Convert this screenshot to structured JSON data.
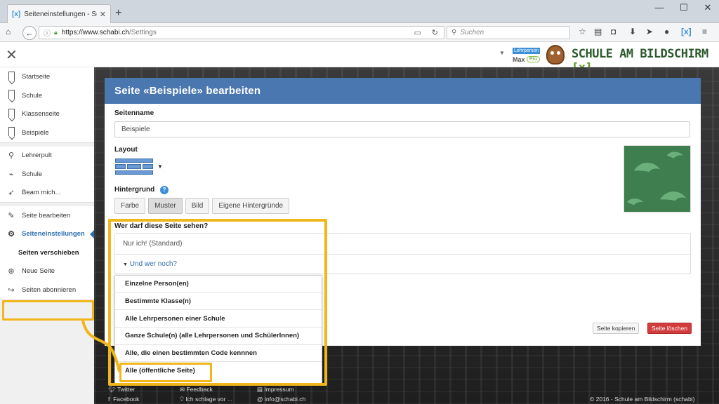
{
  "browser": {
    "tab_title": "Seiteneinstellungen - Schule",
    "url_host": "https://www.schabi.ch",
    "url_path": "/Settings",
    "search_placeholder": "Suchen"
  },
  "header": {
    "user_role": "Lehrperson",
    "user_name": "Max",
    "user_badge": "Pro",
    "brand_text": "SCHULE AM BILDSCHIRM",
    "brand_mark": "[x]"
  },
  "sidebar": {
    "pages": [
      {
        "label": "Startseite"
      },
      {
        "label": "Schule"
      },
      {
        "label": "Klassenseite"
      },
      {
        "label": "Beispiele"
      }
    ],
    "tools": [
      {
        "label": "Lehrerpult",
        "icon": "desk-lamp-icon"
      },
      {
        "label": "Schule",
        "icon": "chart-board-icon"
      },
      {
        "label": "Beam mich...",
        "icon": "rocket-icon"
      }
    ],
    "settings": [
      {
        "label": "Seite bearbeiten",
        "icon": "pencil-icon"
      },
      {
        "label": "Seiteneinstellungen",
        "icon": "gear-icon",
        "active": true
      },
      {
        "label": "Seiten verschieben",
        "sub": true
      },
      {
        "label": "Neue Seite",
        "icon": "plus-circle-icon"
      },
      {
        "label": "Seiten abonnieren",
        "icon": "share-arrow-icon"
      }
    ]
  },
  "dialog": {
    "title": "Seite «Beispiele» bearbeiten",
    "name_label": "Seitenname",
    "name_value": "Beispiele",
    "layout_label": "Layout",
    "background_label": "Hintergrund",
    "background_buttons": [
      "Farbe",
      "Muster",
      "Bild",
      "Eigene Hintergründe"
    ],
    "background_selected": "Muster",
    "visibility_label": "Wer darf diese Seite sehen?",
    "visibility_value": "Nur ich! (Standard)",
    "visibility_more": "Und wer noch?",
    "copy_button": "Seite kopieren",
    "delete_button": "Seite löschen",
    "accent_color": "#4a77b0",
    "delete_color": "#d23c3c"
  },
  "visibility_menu": [
    "Einzelne Person(en)",
    "Bestimmte Klasse(n)",
    "Alle Lehrpersonen einer Schule",
    "Ganze Schule(n) (alle Lehrpersonen und SchülerInnen)",
    "Alle, die einen bestimmten Code kennnen",
    "Alle (öffentliche Seite)"
  ],
  "footer": {
    "twitter": "Twitter",
    "facebook": "Facebook",
    "feedback": "Feedback",
    "suggest": "Ich schlage vor ...",
    "impressum": "Impressum",
    "email": "info@schabi.ch",
    "copyright": "© 2016 - Schule am Bildschirm (schabi)"
  },
  "highlight_color": "#f1b61c"
}
